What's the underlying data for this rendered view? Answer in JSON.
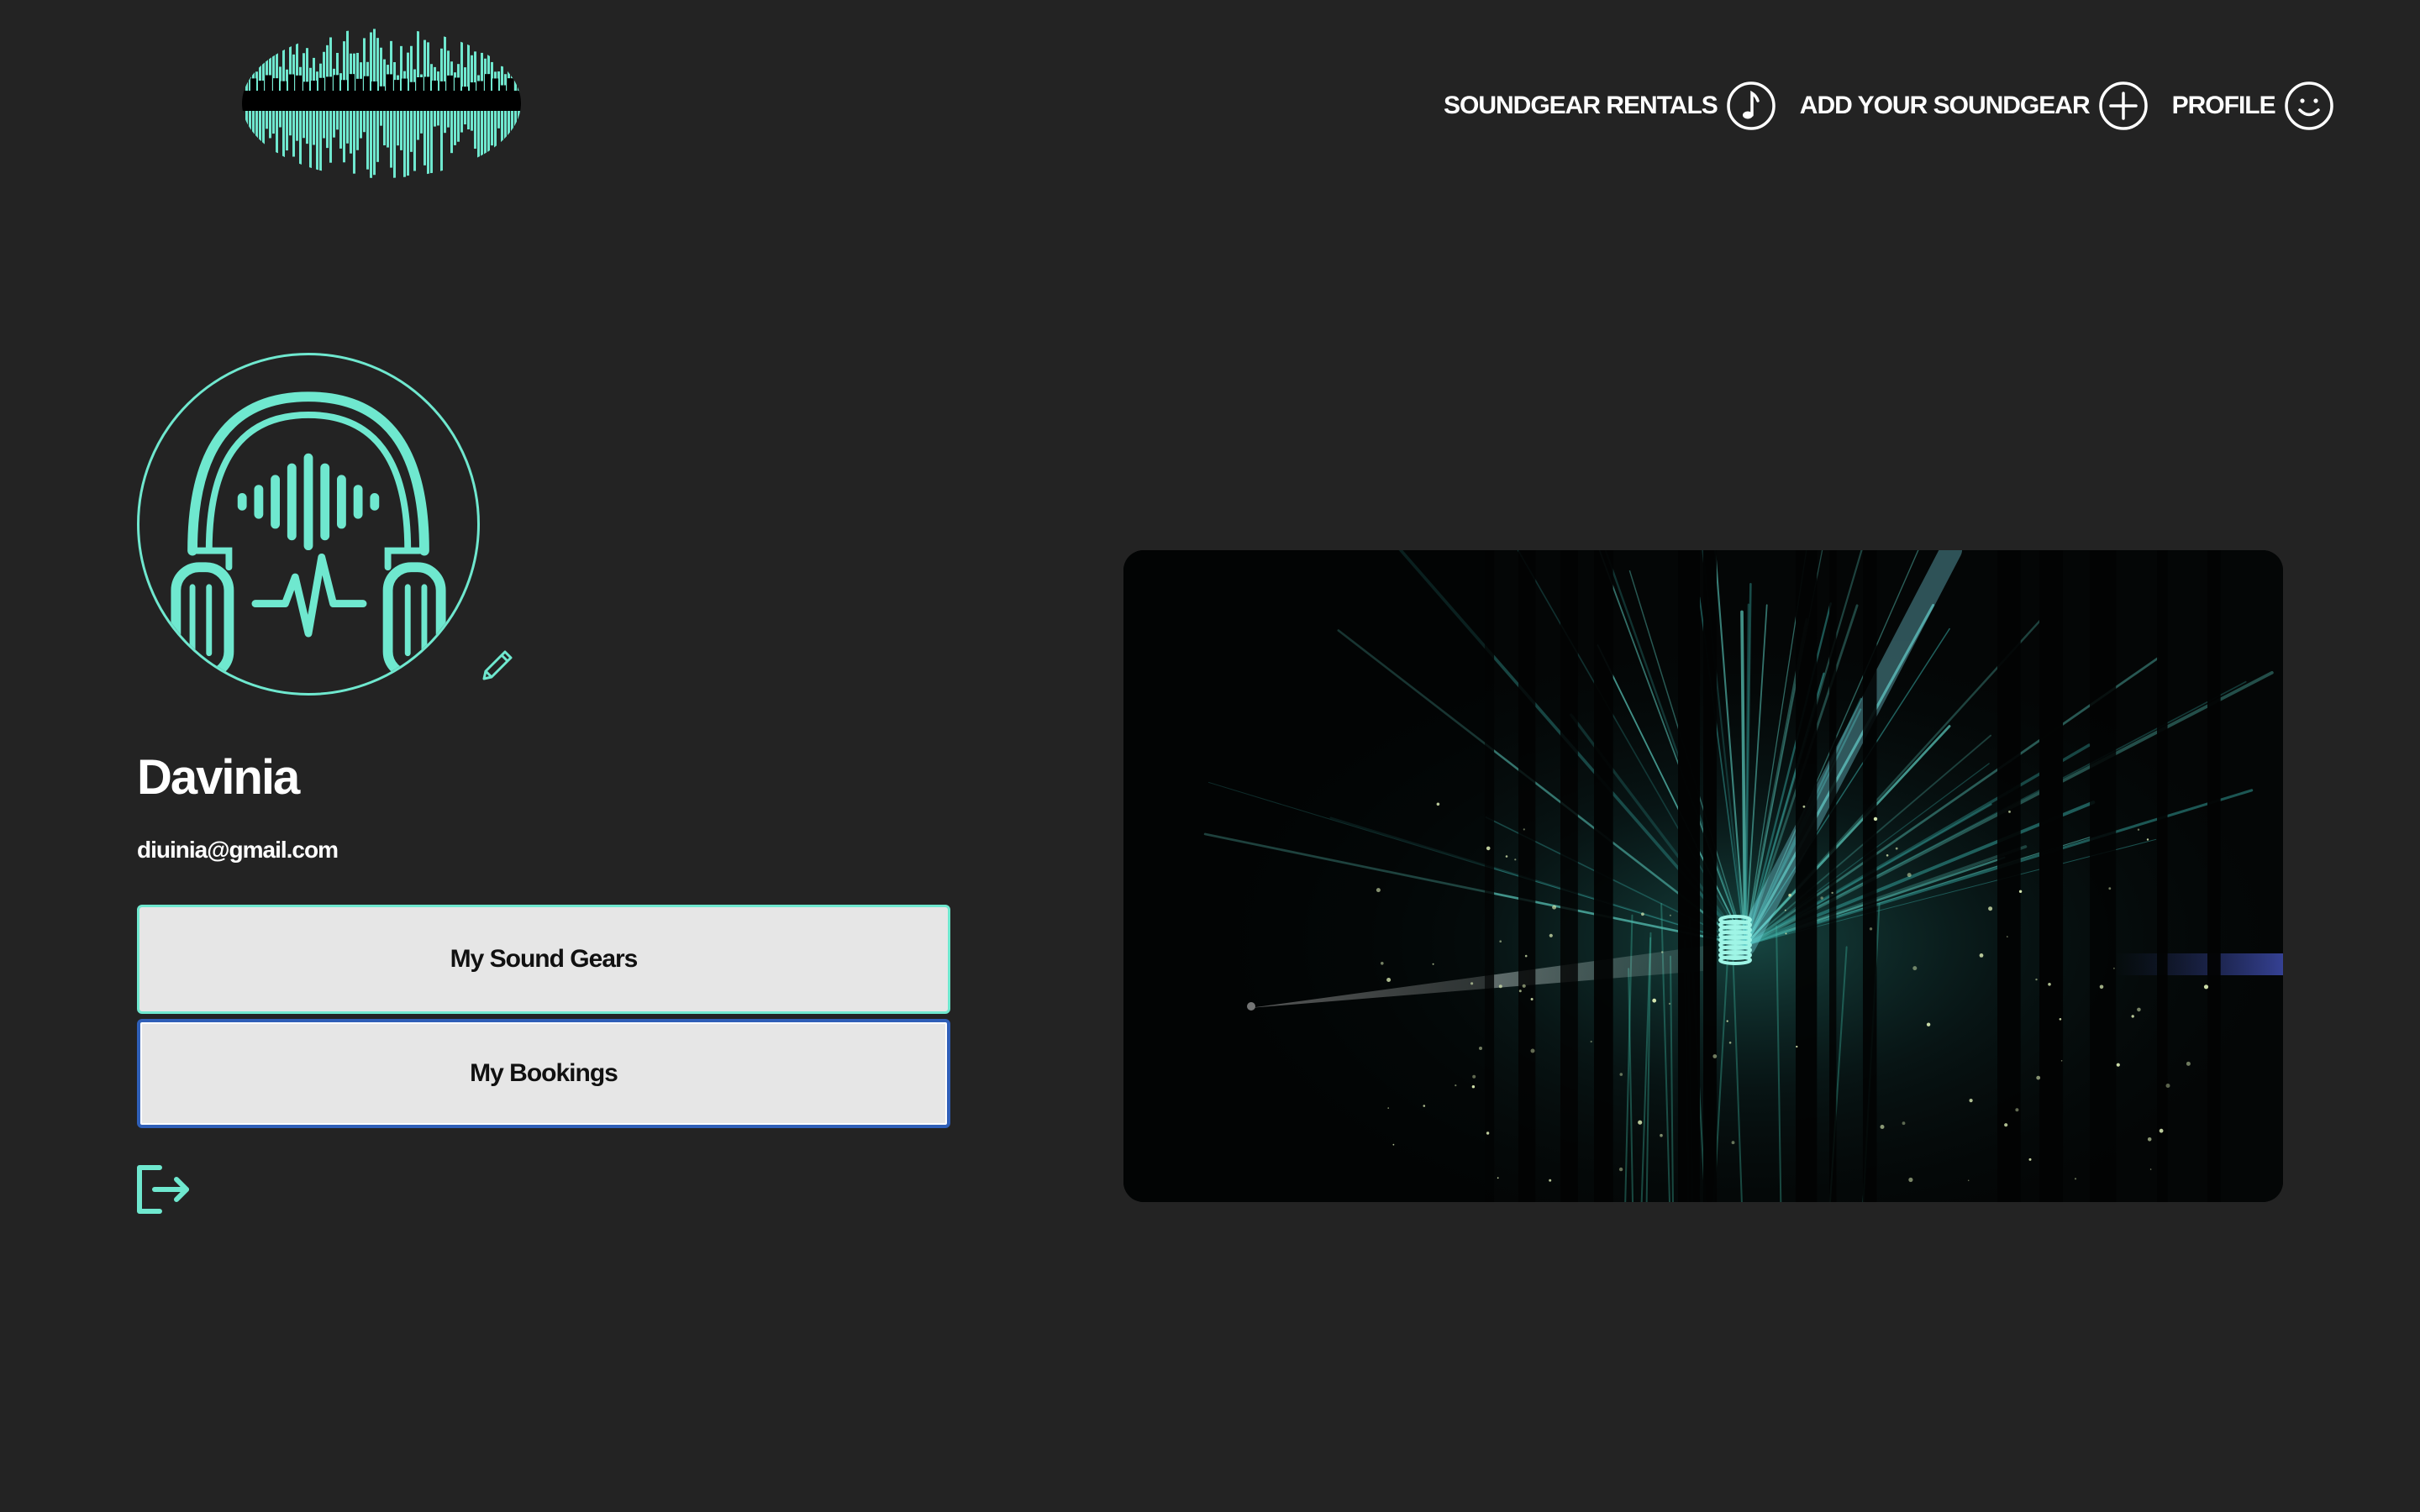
{
  "header": {
    "logo_name": "soundwave-logo",
    "nav": [
      {
        "label": "SOUNDGEAR RENTALS",
        "icon": "music-note-icon"
      },
      {
        "label": "ADD YOUR SOUNDGEAR",
        "icon": "plus-circle-icon"
      },
      {
        "label": "PROFILE",
        "icon": "smiley-icon"
      }
    ]
  },
  "profile": {
    "avatar_icon": "headphones-soundwave-icon",
    "edit_icon": "pencil-icon",
    "name": "Davinia",
    "email": "diuinia@gmail.com",
    "buttons": {
      "my_sound_gears": "My Sound Gears",
      "my_bookings": "My Bookings"
    },
    "logout_icon": "logout-icon"
  },
  "hero": {
    "description_icon": "forest-laser-light-image"
  },
  "colors": {
    "background": "#232323",
    "accent": "#6fe8cf",
    "button_bg": "#e6e6e6",
    "focus_ring": "#2f5fb8",
    "text": "#ffffff"
  }
}
